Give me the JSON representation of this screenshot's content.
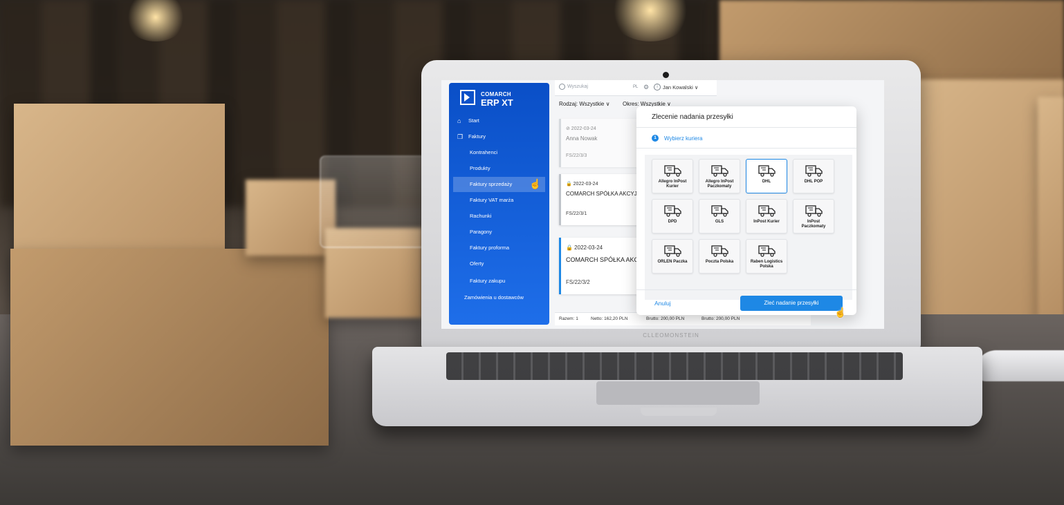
{
  "app": {
    "brand_company": "COMARCH",
    "brand_product": "ERP XT",
    "laptop_label": "CLLEOMONSTEIN"
  },
  "topbar": {
    "search_placeholder": "Wyszukaj",
    "lang": "PL",
    "user": "Jan Kowalski ∨"
  },
  "sidebar": {
    "items": [
      {
        "label": "Start",
        "icon": "home-icon"
      },
      {
        "label": "Faktury",
        "icon": "document-icon"
      },
      {
        "label": "Kontrahenci"
      },
      {
        "label": "Produkty"
      },
      {
        "label": "Faktury sprzedaży",
        "active": true
      },
      {
        "label": "Faktury VAT marża"
      },
      {
        "label": "Rachunki"
      },
      {
        "label": "Paragony"
      },
      {
        "label": "Faktury proforma"
      },
      {
        "label": "Oferty"
      },
      {
        "label": "Faktury zakupu"
      },
      {
        "label": "Zamówienia u dostawców"
      }
    ]
  },
  "filters": {
    "rodzaj": "Rodzaj: Wszystkie ∨",
    "okres": "Okres: Wszystkie ∨"
  },
  "cards": [
    {
      "date": "⊘ 2022-03-24",
      "name": "Anna Nowak",
      "number": "FS/22/3/3"
    },
    {
      "date": "🔒 2022-03-24",
      "name": "COMARCH SPÓŁKA AKCYJNA",
      "number": "FS/22/3/1"
    },
    {
      "date": "🔒 2022-03-24",
      "name": "COMARCH SPÓŁKA AKCYJNA",
      "number": "FS/22/3/2"
    }
  ],
  "footer": {
    "razem": "Razem: 1",
    "netto": "Netto: 162,20 PLN",
    "brutto1": "Brutto: 200,00 PLN",
    "brutto2": "Brutto: 200,00 PLN"
  },
  "modal": {
    "title": "Zlecenie nadania przesyłki",
    "step_number": "1",
    "step_label": "Wybierz kuriera",
    "couriers": [
      {
        "label": "Allegro InPost Kurier"
      },
      {
        "label": "Allegro InPost Paczkomaty"
      },
      {
        "label": "DHL",
        "selected": true
      },
      {
        "label": "DHL POP"
      },
      {
        "label": "DPD"
      },
      {
        "label": "GLS"
      },
      {
        "label": "InPost Kurier"
      },
      {
        "label": "InPost Paczkomaty"
      },
      {
        "label": "ORLEN Paczka"
      },
      {
        "label": "Poczta Polska"
      },
      {
        "label": "Raben Logistics Polska"
      }
    ],
    "cancel_label": "Anuluj",
    "submit_label": "Zleć nadanie przesyłki"
  },
  "colors": {
    "sidebar": "#0a4fc7",
    "accent": "#1e88e5"
  }
}
